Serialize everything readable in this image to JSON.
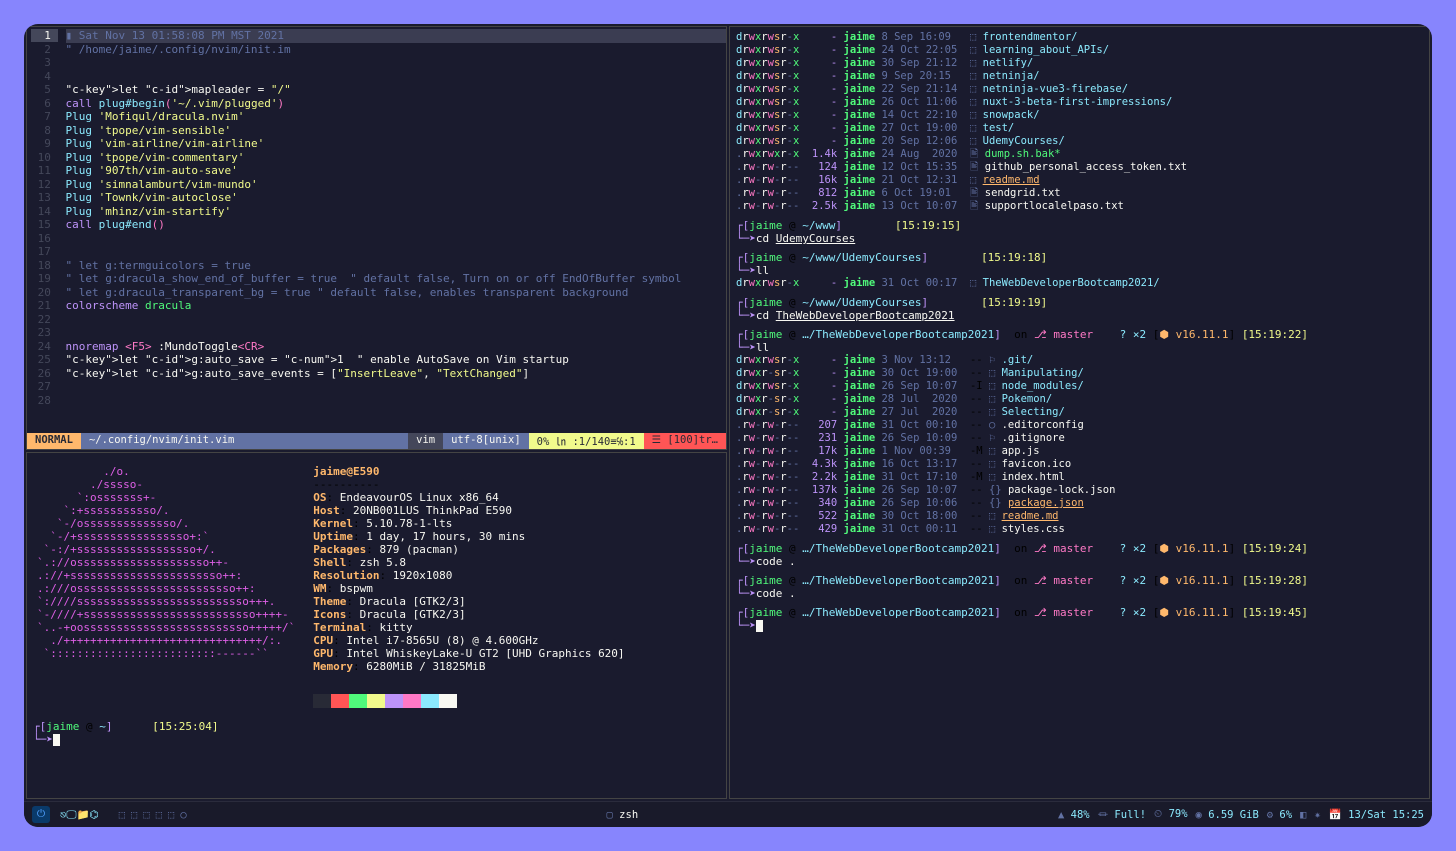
{
  "vim": {
    "timestamp_line": "Sat Nov 13 01:58:08 PM MST 2021",
    "path_comment": "/home/jaime/.config/nvim/init.im",
    "lines": [
      {
        "n": 1,
        "cur": true
      },
      {
        "n": 2
      },
      {
        "n": 3
      },
      {
        "n": 4
      },
      {
        "n": 5,
        "text": "let mapleader = \"/\""
      },
      {
        "n": 6,
        "text": "call plug#begin('~/.vim/plugged')"
      },
      {
        "n": 7,
        "text": "Plug 'Mofiqul/dracula.nvim'"
      },
      {
        "n": 8,
        "text": "Plug 'tpope/vim-sensible'"
      },
      {
        "n": 9,
        "text": "Plug 'vim-airline/vim-airline'"
      },
      {
        "n": 10,
        "text": "Plug 'tpope/vim-commentary'"
      },
      {
        "n": 11,
        "text": "Plug '907th/vim-auto-save'"
      },
      {
        "n": 12,
        "text": "Plug 'simnalamburt/vim-mundo'"
      },
      {
        "n": 13,
        "text": "Plug 'Townk/vim-autoclose'"
      },
      {
        "n": 14,
        "text": "Plug 'mhinz/vim-startify'"
      },
      {
        "n": 15,
        "text": "call plug#end()"
      },
      {
        "n": 16
      },
      {
        "n": 17
      },
      {
        "n": 18,
        "text": "\" let g:termguicolors = true"
      },
      {
        "n": 19,
        "text": "\" let g:dracula_show_end_of_buffer = true  \" default false, Turn on or off EndOfBuffer symbol"
      },
      {
        "n": 20,
        "text": "\" let g:dracula_transparent_bg = true \" default false, enables transparent background"
      },
      {
        "n": 21,
        "text": "colorscheme dracula"
      },
      {
        "n": 22
      },
      {
        "n": 23
      },
      {
        "n": 24,
        "text": "nnoremap <F5> :MundoToggle<CR>"
      },
      {
        "n": 25,
        "text": "let g:auto_save = 1  \" enable AutoSave on Vim startup"
      },
      {
        "n": 26,
        "text": "let g:auto_save_events = [\"InsertLeave\", \"TextChanged\"]"
      },
      {
        "n": 27
      },
      {
        "n": 28
      }
    ],
    "status": {
      "mode": "NORMAL",
      "file": "~/.config/nvim/init.vim",
      "ft": "vim",
      "enc": "utf-8[unix]",
      "pct": "0% ㏑ :1/140≡℅:1",
      "pos": "☰  [100]tr…"
    }
  },
  "neofetch": {
    "header": "jaime@E590",
    "sep": "----------",
    "rows": [
      [
        "OS",
        "EndeavourOS Linux x86_64"
      ],
      [
        "Host",
        "20NB001LUS ThinkPad E590"
      ],
      [
        "Kernel",
        "5.10.78-1-lts"
      ],
      [
        "Uptime",
        "1 day, 17 hours, 30 mins"
      ],
      [
        "Packages",
        "879 (pacman)"
      ],
      [
        "Shell",
        "zsh 5.8"
      ],
      [
        "Resolution",
        "1920x1080"
      ],
      [
        "WM",
        "bspwm"
      ],
      [
        "Theme",
        "Dracula [GTK2/3]"
      ],
      [
        "Icons",
        "Dracula [GTK2/3]"
      ],
      [
        "Terminal",
        "kitty"
      ],
      [
        "CPU",
        "Intel i7-8565U (8) @ 4.600GHz"
      ],
      [
        "GPU",
        "Intel WhiskeyLake-U GT2 [UHD Graphics 620]"
      ],
      [
        "Memory",
        "6280MiB / 31825MiB"
      ]
    ],
    "swatches": [
      "#282a36",
      "#ff5555",
      "#50fa7b",
      "#f1fa8c",
      "#bd93f9",
      "#ff79c6",
      "#8be9fd",
      "#f8f8f2"
    ],
    "prompt": {
      "user": "jaime",
      "path": "~",
      "time": "[15:25:04]"
    }
  },
  "right": {
    "ls1": [
      {
        "perm": "drwxrwsr-x",
        "size": "-",
        "owner": "jaime",
        "date": "8 Sep 16:09",
        "icon": "⬚",
        "name": "frontendmentor/",
        "dir": true
      },
      {
        "perm": "drwxrwsr-x",
        "size": "-",
        "owner": "jaime",
        "date": "24 Oct 22:05",
        "icon": "⬚",
        "name": "learning_about_APIs/",
        "dir": true
      },
      {
        "perm": "drwxrwsr-x",
        "size": "-",
        "owner": "jaime",
        "date": "30 Sep 21:12",
        "icon": "⬚",
        "name": "netlify/",
        "dir": true
      },
      {
        "perm": "drwxrwsr-x",
        "size": "-",
        "owner": "jaime",
        "date": "9 Sep 20:15",
        "icon": "⬚",
        "name": "netninja/",
        "dir": true
      },
      {
        "perm": "drwxrwsr-x",
        "size": "-",
        "owner": "jaime",
        "date": "22 Sep 21:14",
        "icon": "⬚",
        "name": "netninja-vue3-firebase/",
        "dir": true
      },
      {
        "perm": "drwxrwsr-x",
        "size": "-",
        "owner": "jaime",
        "date": "26 Oct 11:06",
        "icon": "⬚",
        "name": "nuxt-3-beta-first-impressions/",
        "dir": true
      },
      {
        "perm": "drwxrwsr-x",
        "size": "-",
        "owner": "jaime",
        "date": "14 Oct 22:10",
        "icon": "⬚",
        "name": "snowpack/",
        "dir": true
      },
      {
        "perm": "drwxrwsr-x",
        "size": "-",
        "owner": "jaime",
        "date": "27 Oct 19:00",
        "icon": "⬚",
        "name": "test/",
        "dir": true
      },
      {
        "perm": "drwxrwsr-x",
        "size": "-",
        "owner": "jaime",
        "date": "20 Sep 12:06",
        "icon": "⬚",
        "name": "UdemyCourses/",
        "dir": true
      },
      {
        "perm": ".rwxrwxr-x",
        "size": "1.4k",
        "owner": "jaime",
        "date": "24 Aug  2020",
        "icon": "🖹",
        "name": "dump.sh.bak*",
        "exec": true
      },
      {
        "perm": ".rw-rw-r--",
        "size": "124",
        "owner": "jaime",
        "date": "12 Oct 15:35",
        "icon": "🖹",
        "name": "github_personal_access_token.txt"
      },
      {
        "perm": ".rw-rw-r--",
        "size": "16k",
        "owner": "jaime",
        "date": "21 Oct 12:31",
        "icon": "⬚",
        "name": "readme.md",
        "ul": true
      },
      {
        "perm": ".rw-rw-r--",
        "size": "812",
        "owner": "jaime",
        "date": "6 Oct 19:01",
        "icon": "🖹",
        "name": "sendgrid.txt"
      },
      {
        "perm": ".rw-rw-r--",
        "size": "2.5k",
        "owner": "jaime",
        "date": "13 Oct 10:07",
        "icon": "🖹",
        "name": "supportlocalelpaso.txt"
      }
    ],
    "prompts": [
      {
        "user": "jaime",
        "path": "~/www",
        "time": "[15:19:15]",
        "cmd": "cd ",
        "arg": "UdemyCourses",
        "arg_ul": true
      },
      {
        "user": "jaime",
        "path": "~/www/UdemyCourses",
        "time": "[15:19:18]",
        "cmd": "ll"
      },
      {
        "ls": [
          {
            "perm": "drwxrwsr-x",
            "size": "-",
            "owner": "jaime",
            "date": "31 Oct 00:17",
            "icon": "⬚",
            "name": "TheWebDeveloperBootcamp2021/",
            "dir": true
          }
        ]
      },
      {
        "user": "jaime",
        "path": "~/www/UdemyCourses",
        "time": "[15:19:19]",
        "cmd": "cd ",
        "arg": "TheWebDeveloperBootcamp2021",
        "arg_ul": true
      },
      {
        "user": "jaime",
        "path": "…/TheWebDeveloperBootcamp2021",
        "branch": "master",
        "ahead": "? ×2",
        "node": "v16.11.1",
        "time": "[15:19:22]",
        "cmd": "ll"
      },
      {
        "ls": [
          {
            "perm": "drwxrwsr-x",
            "size": "-",
            "owner": "jaime",
            "date": "3 Nov 13:12",
            "flag": "--",
            "icon": "⚐",
            "name": ".git/",
            "dir": true
          },
          {
            "perm": "drwxr-sr-x",
            "size": "-",
            "owner": "jaime",
            "date": "30 Oct 19:00",
            "flag": "--",
            "icon": "⬚",
            "name": "Manipulating/",
            "dir": true
          },
          {
            "perm": "drwxrwsr-x",
            "size": "-",
            "owner": "jaime",
            "date": "26 Sep 10:07",
            "flag": "-I",
            "icon": "⬚",
            "name": "node_modules/",
            "dir": true
          },
          {
            "perm": "drwxr-sr-x",
            "size": "-",
            "owner": "jaime",
            "date": "28 Jul  2020",
            "flag": "--",
            "icon": "⬚",
            "name": "Pokemon/",
            "dir": true
          },
          {
            "perm": "drwxr-sr-x",
            "size": "-",
            "owner": "jaime",
            "date": "27 Jul  2020",
            "flag": "--",
            "icon": "⬚",
            "name": "Selecting/",
            "dir": true
          },
          {
            "perm": ".rw-rw-r--",
            "size": "207",
            "owner": "jaime",
            "date": "31 Oct 00:10",
            "flag": "--",
            "icon": "○",
            "name": ".editorconfig"
          },
          {
            "perm": ".rw-rw-r--",
            "size": "231",
            "owner": "jaime",
            "date": "26 Sep 10:09",
            "flag": "--",
            "icon": "⚐",
            "name": ".gitignore"
          },
          {
            "perm": ".rw-rw-r--",
            "size": "17k",
            "owner": "jaime",
            "date": "1 Nov 00:39",
            "flag": "-M",
            "icon": "⬚",
            "name": "app.js"
          },
          {
            "perm": ".rw-rw-r--",
            "size": "4.3k",
            "owner": "jaime",
            "date": "16 Oct 13:17",
            "flag": "--",
            "icon": "⬚",
            "name": "favicon.ico"
          },
          {
            "perm": ".rw-rw-r--",
            "size": "2.2k",
            "owner": "jaime",
            "date": "31 Oct 17:10",
            "flag": "-M",
            "icon": "⬚",
            "name": "index.html"
          },
          {
            "perm": ".rw-rw-r--",
            "size": "137k",
            "owner": "jaime",
            "date": "26 Sep 10:07",
            "flag": "--",
            "icon": "{}",
            "name": "package-lock.json"
          },
          {
            "perm": ".rw-rw-r--",
            "size": "340",
            "owner": "jaime",
            "date": "26 Sep 10:06",
            "flag": "--",
            "icon": "{}",
            "name": "package.json",
            "ul": true
          },
          {
            "perm": ".rw-rw-r--",
            "size": "522",
            "owner": "jaime",
            "date": "30 Oct 18:00",
            "flag": "--",
            "icon": "⬚",
            "name": "readme.md",
            "ul": true
          },
          {
            "perm": ".rw-rw-r--",
            "size": "429",
            "owner": "jaime",
            "date": "31 Oct 00:11",
            "flag": "--",
            "icon": "⬚",
            "name": "styles.css"
          }
        ]
      },
      {
        "user": "jaime",
        "path": "…/TheWebDeveloperBootcamp2021",
        "branch": "master",
        "ahead": "? ×2",
        "node": "v16.11.1",
        "time": "[15:19:24]",
        "cmd": "code ",
        "arg": "."
      },
      {
        "user": "jaime",
        "path": "…/TheWebDeveloperBootcamp2021",
        "branch": "master",
        "ahead": "? ×2",
        "node": "v16.11.1",
        "time": "[15:19:28]",
        "cmd": "code ",
        "arg": "."
      },
      {
        "user": "jaime",
        "path": "…/TheWebDeveloperBootcamp2021",
        "branch": "master",
        "ahead": "? ×2",
        "node": "v16.11.1",
        "time": "[15:19:45]",
        "cmd": "",
        "cursor": true
      }
    ]
  },
  "taskbar": {
    "icons": [
      "⎋",
      "🖵",
      "📁",
      "</>",
      "⌬"
    ],
    "workspaces": [
      "⬚",
      "⬚",
      "⬚",
      "⬚",
      "⬚",
      "○"
    ],
    "center_app": "zsh",
    "center_icon": "▢",
    "right": [
      {
        "icon": "▲",
        "val": "48%"
      },
      {
        "icon": "⏛",
        "val": "Full!"
      },
      {
        "icon": "⏲",
        "val": "79%"
      },
      {
        "icon": "◉",
        "val": "6.59 GiB"
      },
      {
        "icon": "⚙",
        "val": "6%"
      },
      {
        "icon": "◧",
        "val": ""
      },
      {
        "icon": "✷",
        "val": ""
      },
      {
        "icon": "📅",
        "val": "13/Sat 15:25"
      }
    ]
  },
  "ascii_art": "          ./o.\n        ./sssso-\n      `:osssssss+-\n    `:+sssssssssso/.\n   `-/ossssssssssssso/.\n  `-/+sssssssssssssssso+:`\n `-:/+ssssssssssssssssso+/.\n`.://ossssssssssssssssssso++-\n.://+sssssssssssssssssssssso++:\n.:///ossssssssssssssssssssssso++:\n`:////ssssssssssssssssssssssssso+++.\n`-////+ssssssssssssssssssssssssso++++-\n`..-+oosssssssssssssssssssssssso+++++/`\n  ./++++++++++++++++++++++++++++++/:.\n `:::::::::::::::::::::::::------``"
}
